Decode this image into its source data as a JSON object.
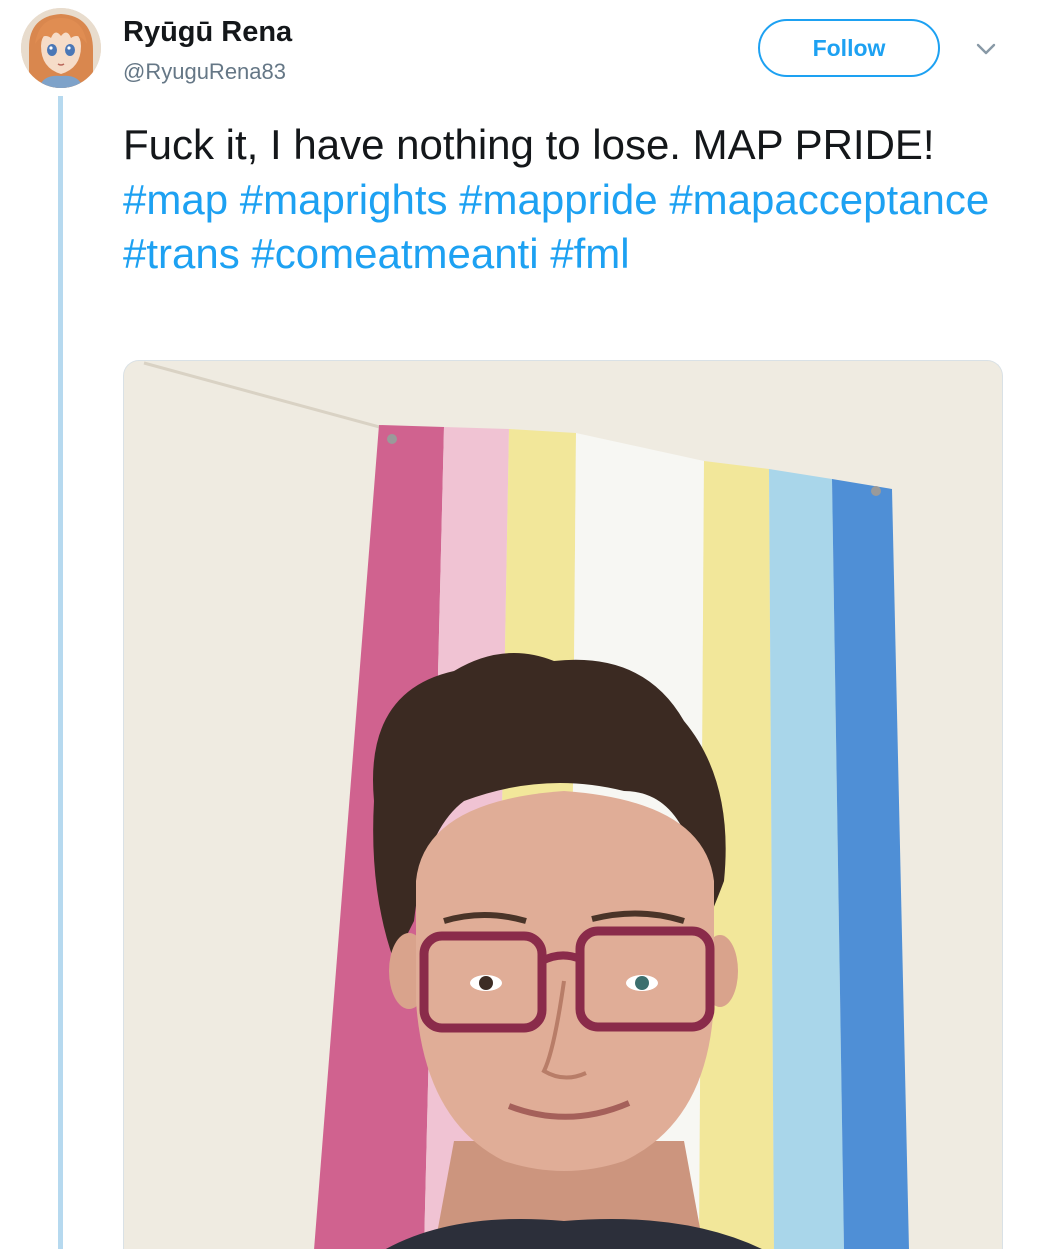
{
  "user": {
    "display_name": "Ryūgū Rena",
    "handle": "@RyuguRena83",
    "avatar_icon": "anime-avatar-icon"
  },
  "actions": {
    "follow_label": "Follow",
    "more_icon": "chevron-down-icon"
  },
  "tweet": {
    "text_plain": "Fuck it, I have nothing to lose. MAP PRIDE!",
    "hashtags": [
      "#map",
      "#maprights",
      "#mappride",
      "#mapacceptance",
      "#trans",
      "#comeatmeanti",
      "#fml"
    ]
  },
  "colors": {
    "link_blue": "#1da1f2",
    "thread_line": "#b6d9ef",
    "handle_gray": "#657786",
    "flag_stripes": [
      "#d0628f",
      "#f0c3d3",
      "#f2e79a",
      "#f7f7f7",
      "#f2e79a",
      "#a9d6ea",
      "#4f8fd6"
    ]
  }
}
